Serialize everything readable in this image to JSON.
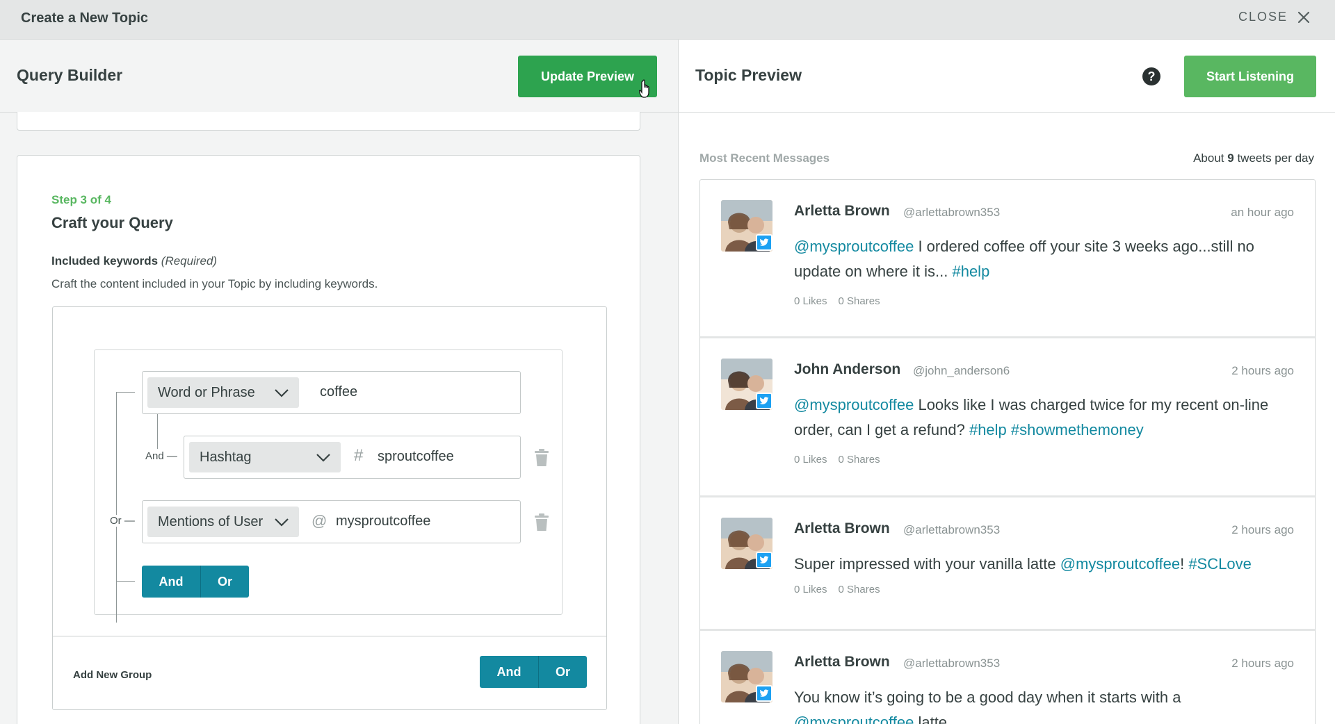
{
  "topbar": {
    "title": "Create a New Topic",
    "close_label": "CLOSE"
  },
  "left": {
    "header": "Query Builder",
    "update_button": "Update Preview",
    "step": "Step 3 of 4",
    "step_title": "Craft your Query",
    "included_label": "Included keywords",
    "included_required": "(Required)",
    "included_desc": "Craft the content included in your Topic by including keywords.",
    "rows": [
      {
        "type": "Word or Phrase",
        "prefix": "",
        "value": "coffee"
      },
      {
        "type": "Hashtag",
        "prefix": "#",
        "value": "sproutcoffee"
      },
      {
        "type": "Mentions of User",
        "prefix": "@",
        "value": "mysproutcoffee"
      }
    ],
    "connector_and": "And —",
    "connector_or": "Or —",
    "group_and": "And",
    "group_or": "Or",
    "add_new_group": "Add New Group",
    "add_and": "And",
    "add_or": "Or"
  },
  "right": {
    "header": "Topic Preview",
    "help_icon": "?",
    "listen_button": "Start Listening",
    "most_recent": "Most Recent Messages",
    "rate_prefix": "About ",
    "rate_count": "9",
    "rate_suffix": " tweets per day",
    "messages": [
      {
        "name": "Arletta Brown",
        "handle": "@arlettabrown353",
        "time": "an hour ago",
        "segments": [
          {
            "kind": "m",
            "text": "@mysproutcoffee"
          },
          {
            "kind": "p",
            "text": " I ordered coffee off your site 3 weeks ago...still no update on where it is... "
          },
          {
            "kind": "t",
            "text": "#help"
          }
        ],
        "likes": "0 Likes",
        "shares": "0 Shares"
      },
      {
        "name": "John Anderson",
        "handle": "@john_anderson6",
        "time": "2 hours ago",
        "segments": [
          {
            "kind": "m",
            "text": "@mysproutcoffee"
          },
          {
            "kind": "p",
            "text": " Looks like I was charged twice for my recent on-line order, can I get a refund? "
          },
          {
            "kind": "t",
            "text": "#help"
          },
          {
            "kind": "p",
            "text": " "
          },
          {
            "kind": "t",
            "text": "#showmethemoney"
          }
        ],
        "likes": "0 Likes",
        "shares": "0 Shares"
      },
      {
        "name": "Arletta Brown",
        "handle": "@arlettabrown353",
        "time": "2 hours ago",
        "segments": [
          {
            "kind": "p",
            "text": "Super impressed with your vanilla latte "
          },
          {
            "kind": "m",
            "text": "@mysproutcoffee"
          },
          {
            "kind": "p",
            "text": "! "
          },
          {
            "kind": "t",
            "text": "#SCLove"
          }
        ],
        "likes": "0 Likes",
        "shares": "0 Shares"
      },
      {
        "name": "Arletta Brown",
        "handle": "@arlettabrown353",
        "time": "2 hours ago",
        "segments": [
          {
            "kind": "p",
            "text": "You know it’s going to be a good day when it starts with a "
          },
          {
            "kind": "m",
            "text": "@mysproutcoffee"
          },
          {
            "kind": "p",
            "text": " latte"
          }
        ],
        "likes": "",
        "shares": ""
      }
    ]
  },
  "colors": {
    "green": "#2da34f",
    "light_green": "#59b761",
    "teal": "#1389a0",
    "twitter": "#1da1f2"
  }
}
